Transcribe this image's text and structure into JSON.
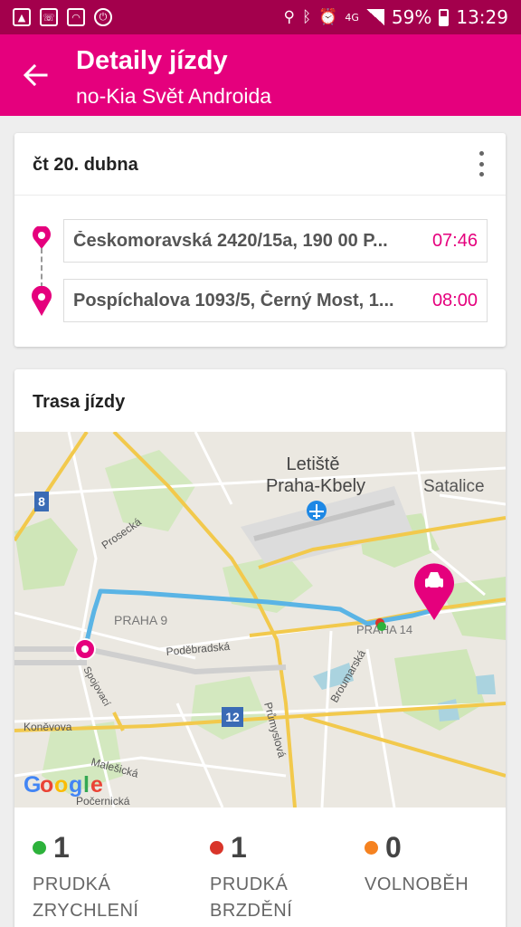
{
  "status_bar": {
    "battery": "59%",
    "time": "13:29",
    "network": "4G",
    "icons_left": [
      "image-icon",
      "wifi-call-icon",
      "wifi-box-icon",
      "power-icon"
    ],
    "icons_right": [
      "location-icon",
      "bluetooth-icon",
      "alarm-icon",
      "signal-icon",
      "battery-icon"
    ]
  },
  "app_bar": {
    "title": "Detaily jízdy",
    "subtitle": "no-Kia Svět Androida"
  },
  "trip": {
    "date": "čt 20. dubna",
    "stops": [
      {
        "address": "Českomoravská 2420/15a, 190 00 P...",
        "time": "07:46"
      },
      {
        "address": "Pospíchalova 1093/5, Černý Most, 1...",
        "time": "08:00"
      }
    ]
  },
  "route": {
    "title": "Trasa jízdy",
    "map_labels": {
      "airport_line1": "Letiště",
      "airport_line2": "Praha-Kbely",
      "satalice": "Satalice",
      "prosecka": "Prosecká",
      "praha9": "PRAHA 9",
      "praha14": "PRAHA 14",
      "podebradska": "Poděbradská",
      "spojovaci": "Spojovací",
      "konevova": "Koněvova",
      "malesicka": "Malešická",
      "pocernicka": "Počernická",
      "prumyslova": "Průmyslová",
      "broumarska": "Broumarská",
      "road8": "8",
      "road12": "12"
    },
    "google": [
      "G",
      "o",
      "o",
      "g",
      "l",
      "e"
    ]
  },
  "stats": [
    {
      "value": "1",
      "label_line1": "PRUDKÁ",
      "label_line2": "ZRYCHLENÍ",
      "color": "#2db23b"
    },
    {
      "value": "1",
      "label_line1": "PRUDKÁ",
      "label_line2": "BRZDĚNÍ",
      "color": "#d9352a"
    },
    {
      "value": "0",
      "label_line1": "VOLNOBĚH",
      "label_line2": "",
      "color": "#f58220"
    }
  ],
  "colors": {
    "status_bar": "#a3004c",
    "app_bar": "#e5007d",
    "accent": "#e5007d",
    "route_line": "#5ab4e5"
  }
}
